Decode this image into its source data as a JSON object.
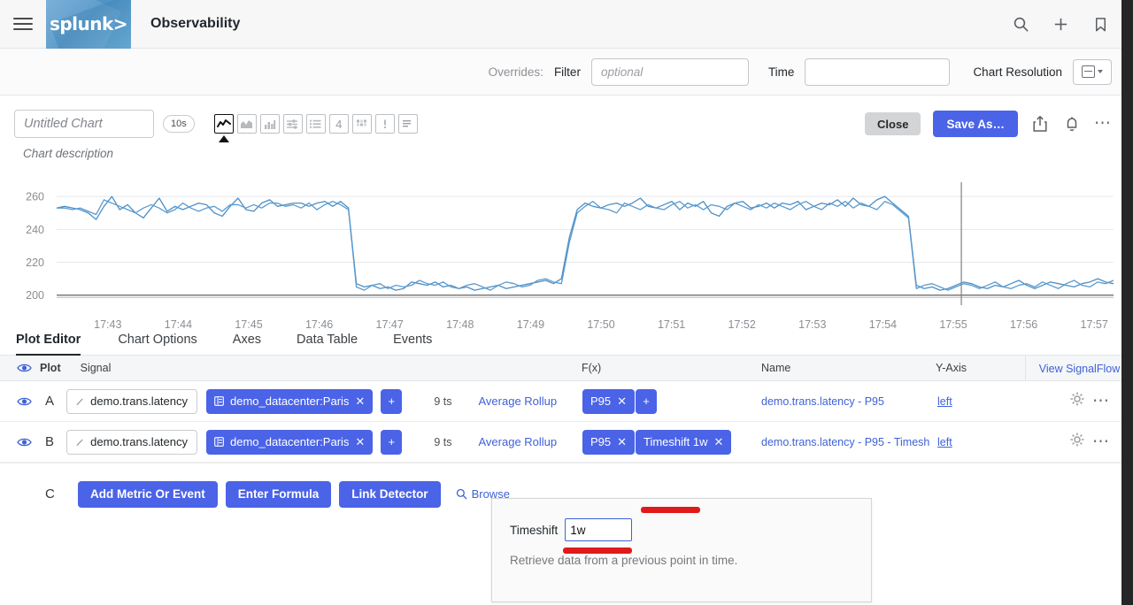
{
  "topnav": {
    "menu_icon": "hamburger-icon",
    "logo_text": "splunk>",
    "app_title": "Observability",
    "icons": [
      {
        "name": "search-icon",
        "label": "Search"
      },
      {
        "name": "plus-icon",
        "label": "Create"
      },
      {
        "name": "bookmark-icon",
        "label": "Bookmarks"
      }
    ]
  },
  "overrides": {
    "label": "Overrides:",
    "filter_label": "Filter",
    "filter_value": "",
    "filter_placeholder": "optional",
    "time_label": "Time",
    "time_value": "",
    "time_placeholder": "",
    "chart_resolution_label": "Chart Resolution",
    "chart_resolution_value": "auto"
  },
  "chart_header": {
    "name_value": "",
    "name_placeholder": "Untitled Chart",
    "resolution_pill": "10s",
    "description_placeholder": "Chart description",
    "viz_types": [
      {
        "name": "line-chart-icon",
        "label": "Line Chart",
        "selected": true
      },
      {
        "name": "area-chart-icon",
        "label": "Area Chart",
        "selected": false
      },
      {
        "name": "column-chart-icon",
        "label": "Column Chart",
        "selected": false
      },
      {
        "name": "histogram-icon",
        "label": "Histogram",
        "selected": false
      },
      {
        "name": "list-icon",
        "label": "List",
        "selected": false
      },
      {
        "name": "single-value-icon",
        "label": "Single Value",
        "selected": false
      },
      {
        "name": "heatmap-icon",
        "label": "Heatmap",
        "selected": false
      },
      {
        "name": "event-feed-icon",
        "label": "Event Feed",
        "selected": false
      },
      {
        "name": "text-note-icon",
        "label": "Text Note",
        "selected": false
      }
    ],
    "close_label": "Close",
    "save_as_label": "Save As…",
    "share_icon": "share-icon",
    "alert_icon": "bell-icon",
    "more_icon": "ellipsis-icon"
  },
  "tabs": [
    {
      "label": "Plot Editor",
      "active": true
    },
    {
      "label": "Chart Options",
      "active": false
    },
    {
      "label": "Axes",
      "active": false
    },
    {
      "label": "Data Table",
      "active": false
    },
    {
      "label": "Events",
      "active": false
    }
  ],
  "table": {
    "headers": {
      "plot": "Plot",
      "signal": "Signal",
      "fx": "F(x)",
      "name": "Name",
      "yaxis": "Y-Axis",
      "signalflow": "View SignalFlow"
    },
    "rows": [
      {
        "letter": "A",
        "signal": "demo.trans.latency",
        "filter_chip": "demo_datacenter:Paris",
        "add_filter": "+",
        "ts_count": "9 ts",
        "rollup": "Average Rollup",
        "fx_chips": [
          "P95"
        ],
        "add_fx": "+",
        "name": "demo.trans.latency - P95",
        "yaxis": "left"
      },
      {
        "letter": "B",
        "signal": "demo.trans.latency",
        "filter_chip": "demo_datacenter:Paris",
        "add_filter": "+",
        "ts_count": "9 ts",
        "rollup": "Average Rollup",
        "fx_chips": [
          "P95",
          "Timeshift 1w"
        ],
        "add_fx": "",
        "name": "demo.trans.latency - P95 - Timeshi",
        "yaxis": "left"
      }
    ],
    "add_row": {
      "letter": "C",
      "add_metric_label": "Add Metric Or Event",
      "enter_formula_label": "Enter Formula",
      "link_detector_label": "Link Detector",
      "browse_label": "Browse"
    }
  },
  "popover": {
    "label": "Timeshift",
    "value": "1w",
    "help": "Retrieve data from a previous point in time."
  },
  "colors": {
    "accent_blue": "#4a63e7",
    "link_blue": "#3f62d8",
    "series_blue": "#4e8fc4",
    "highlight_red": "#e01a1a"
  },
  "chart_data": {
    "type": "line",
    "title": "",
    "xlabel": "",
    "ylabel": "",
    "ylim": [
      195,
      266
    ],
    "yticks": [
      200,
      220,
      240,
      260
    ],
    "xticks": [
      "17:43",
      "17:44",
      "17:45",
      "17:46",
      "17:47",
      "17:48",
      "17:49",
      "17:50",
      "17:51",
      "17:52",
      "17:53",
      "17:54",
      "17:55",
      "17:56",
      "17:57"
    ],
    "grid": true,
    "legend": "none",
    "annotations": [
      {
        "type": "vertical-line",
        "x": "17:55.5"
      }
    ],
    "series": [
      {
        "name": "demo.trans.latency - P95",
        "color": "#4e8fc4",
        "values": [
          253,
          254,
          253,
          252,
          250,
          246,
          254,
          260,
          252,
          255,
          250,
          247,
          253,
          259,
          251,
          254,
          252,
          254,
          256,
          255,
          250,
          248,
          254,
          259,
          252,
          251,
          256,
          258,
          254,
          255,
          256,
          256,
          254,
          256,
          257,
          254,
          257,
          253,
          207,
          205,
          206,
          204,
          205,
          203,
          204,
          208,
          207,
          206,
          208,
          205,
          206,
          204,
          205,
          203,
          204,
          205,
          206,
          204,
          205,
          206,
          207,
          208,
          209,
          207,
          210,
          235,
          252,
          256,
          254,
          253,
          255,
          256,
          254,
          256,
          259,
          254,
          253,
          255,
          257,
          252,
          256,
          254,
          257,
          250,
          248,
          254,
          256,
          257,
          253,
          254,
          256,
          253,
          256,
          255,
          257,
          252,
          254,
          256,
          255,
          258,
          254,
          259,
          255,
          254,
          258,
          260,
          256,
          252,
          248,
          206,
          204,
          205,
          203,
          204,
          206,
          208,
          207,
          205,
          204,
          206,
          205,
          207,
          209,
          206,
          204,
          206,
          208,
          207,
          206,
          205,
          207,
          208,
          210,
          208,
          207
        ]
      },
      {
        "name": "demo.trans.latency - P95 - Timeshift 1w",
        "color": "#5b9bd0",
        "values": [
          253,
          253,
          252,
          253,
          251,
          249,
          258,
          256,
          254,
          252,
          250,
          253,
          255,
          253,
          250,
          252,
          256,
          253,
          251,
          253,
          254,
          251,
          255,
          255,
          253,
          255,
          253,
          256,
          256,
          254,
          255,
          253,
          256,
          252,
          255,
          257,
          255,
          252,
          205,
          203,
          206,
          207,
          204,
          206,
          205,
          206,
          209,
          207,
          206,
          208,
          205,
          204,
          206,
          207,
          205,
          203,
          206,
          208,
          207,
          205,
          206,
          209,
          210,
          208,
          207,
          232,
          250,
          254,
          257,
          253,
          252,
          250,
          256,
          254,
          252,
          255,
          253,
          252,
          255,
          257,
          253,
          255,
          252,
          255,
          254,
          252,
          256,
          254,
          252,
          255,
          253,
          256,
          254,
          252,
          255,
          257,
          254,
          252,
          256,
          254,
          257,
          253,
          256,
          254,
          252,
          257,
          255,
          251,
          247,
          204,
          206,
          207,
          205,
          203,
          205,
          207,
          206,
          204,
          206,
          208,
          205,
          204,
          206,
          207,
          205,
          208,
          206,
          204,
          207,
          209,
          206,
          205,
          208,
          207,
          209
        ]
      }
    ]
  }
}
